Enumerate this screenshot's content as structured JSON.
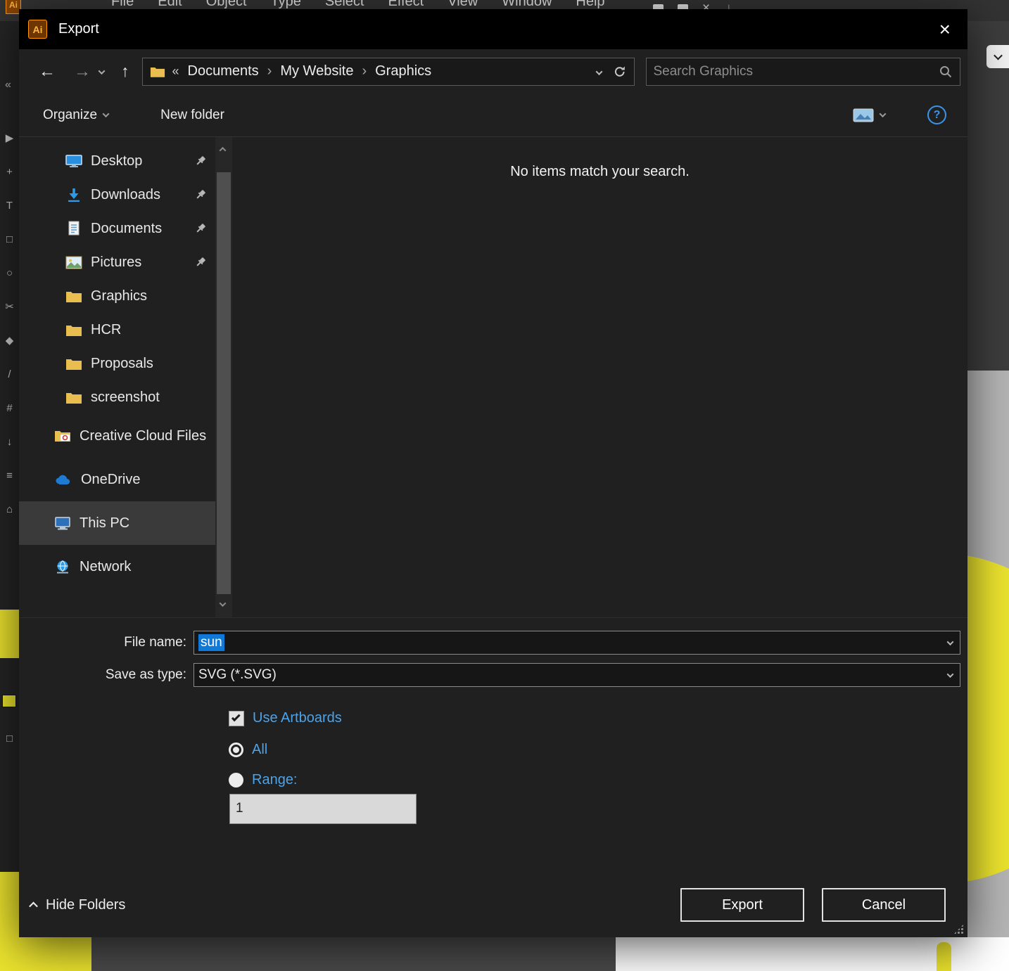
{
  "colors": {
    "artwork-yellow": "#ece42e",
    "link-blue": "#4da3e8",
    "selection-blue": "#1079d8",
    "folder-yellow": "#e9bd4f"
  },
  "app": {
    "menu": [
      "File",
      "Edit",
      "Object",
      "Type",
      "Select",
      "Effect",
      "View",
      "Window",
      "Help"
    ],
    "close_glyph": "×",
    "download_glyph": "↓",
    "collapse_glyph": "«",
    "tool_glyphs": [
      "▶",
      "+",
      "T",
      "□",
      "○",
      "✂",
      "◆",
      "/",
      "#",
      "↓",
      "≡",
      "⌂"
    ],
    "lower_tool_glyph": "□"
  },
  "dialog": {
    "title": "Export",
    "nav": {
      "back": "←",
      "forward": "→",
      "up": "↑"
    },
    "breadcrumb": {
      "overflow": "«",
      "separator": "›",
      "segments": [
        "Documents",
        "My Website",
        "Graphics"
      ]
    },
    "search": {
      "placeholder": "Search Graphics"
    },
    "toolbar": {
      "organize": "Organize",
      "new_folder": "New folder",
      "help": "?"
    },
    "sidebar": {
      "items": [
        {
          "label": "Desktop",
          "icon": "desktop-monitor-icon",
          "pinned": true
        },
        {
          "label": "Downloads",
          "icon": "download-arrow-icon",
          "pinned": true
        },
        {
          "label": "Documents",
          "icon": "document-icon",
          "pinned": true
        },
        {
          "label": "Pictures",
          "icon": "pictures-icon",
          "pinned": true
        },
        {
          "label": "Graphics",
          "icon": "folder-icon",
          "pinned": false
        },
        {
          "label": "HCR",
          "icon": "folder-icon",
          "pinned": false
        },
        {
          "label": "Proposals",
          "icon": "folder-icon",
          "pinned": false
        },
        {
          "label": "screenshot",
          "icon": "folder-icon",
          "pinned": false
        },
        {
          "label": "Creative Cloud Files",
          "icon": "creative-cloud-icon",
          "pinned": false
        },
        {
          "label": "OneDrive",
          "icon": "onedrive-cloud-icon",
          "pinned": false
        },
        {
          "label": "This PC",
          "icon": "computer-icon",
          "pinned": false,
          "selected": true
        },
        {
          "label": "Network",
          "icon": "network-globe-icon",
          "pinned": false
        }
      ]
    },
    "file_list": {
      "empty_message": "No items match your search."
    },
    "fields": {
      "file_name_label": "File name:",
      "file_name_value": "sun",
      "save_as_type_label": "Save as type:",
      "save_as_type_value": "SVG (*.SVG)"
    },
    "options": {
      "use_artboards": "Use Artboards",
      "use_artboards_checked": true,
      "all": "All",
      "all_selected": true,
      "range": "Range:",
      "range_selected": false,
      "range_value": "1"
    },
    "footer": {
      "hide_folders": "Hide Folders",
      "export": "Export",
      "cancel": "Cancel"
    }
  }
}
